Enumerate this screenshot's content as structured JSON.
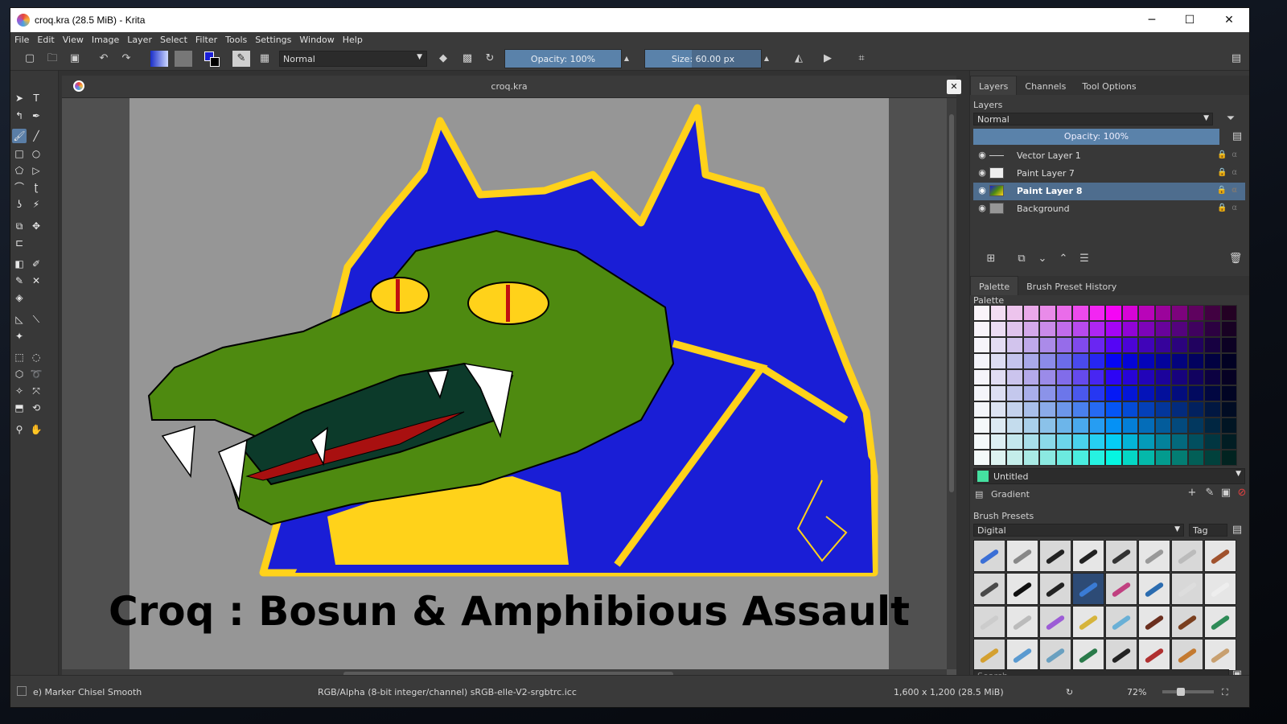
{
  "window": {
    "title": "croq.kra (28.5 MiB)  - Krita",
    "controls": {
      "minimize": "─",
      "maximize": "☐",
      "close": "✕"
    }
  },
  "menu": [
    "File",
    "Edit",
    "View",
    "Image",
    "Layer",
    "Select",
    "Filter",
    "Tools",
    "Settings",
    "Window",
    "Help"
  ],
  "toolbar": {
    "blend_mode": "Normal",
    "opacity_label": "Opacity: 100%",
    "opacity_value": 1.0,
    "size_label": "Size: 60.00 px",
    "size_fill_fraction": 0.4
  },
  "document": {
    "tab_title": "croq.kra",
    "close_label": "✕",
    "caption": "Croq : Bosun & Amphibious Assault"
  },
  "dock": {
    "tabs": [
      "Layers",
      "Channels",
      "Tool Options"
    ],
    "layers_title": "Layers",
    "layers_blend": "Normal",
    "layers_opacity": "Opacity:  100%",
    "layers": [
      {
        "name": "Vector Layer 1",
        "selected": false
      },
      {
        "name": "Paint Layer 7",
        "selected": false
      },
      {
        "name": "Paint Layer 8",
        "selected": true
      },
      {
        "name": "Background",
        "selected": false
      }
    ],
    "palette_tabs": [
      "Palette",
      "Brush Preset History"
    ],
    "palette_title": "Palette",
    "palette_name": "Untitled",
    "gradient_label": "Gradient",
    "brush_presets_title": "Brush Presets",
    "brush_presets_tag": "Digital",
    "tag_label": "Tag",
    "search_placeholder": "Search"
  },
  "status": {
    "brush": "e) Marker Chisel Smooth",
    "colorspace": "RGB/Alpha (8-bit integer/channel)  sRGB-elle-V2-srgbtrc.icc",
    "dimensions": "1,600 x 1,200 (28.5 MiB)",
    "zoom": "72%"
  },
  "colors": {
    "accent": "#5a82aa",
    "art_blue": "#1a1ed6",
    "art_green": "#4e8a10",
    "art_yellow": "#ffd21a",
    "canvas_gray": "#969696"
  }
}
